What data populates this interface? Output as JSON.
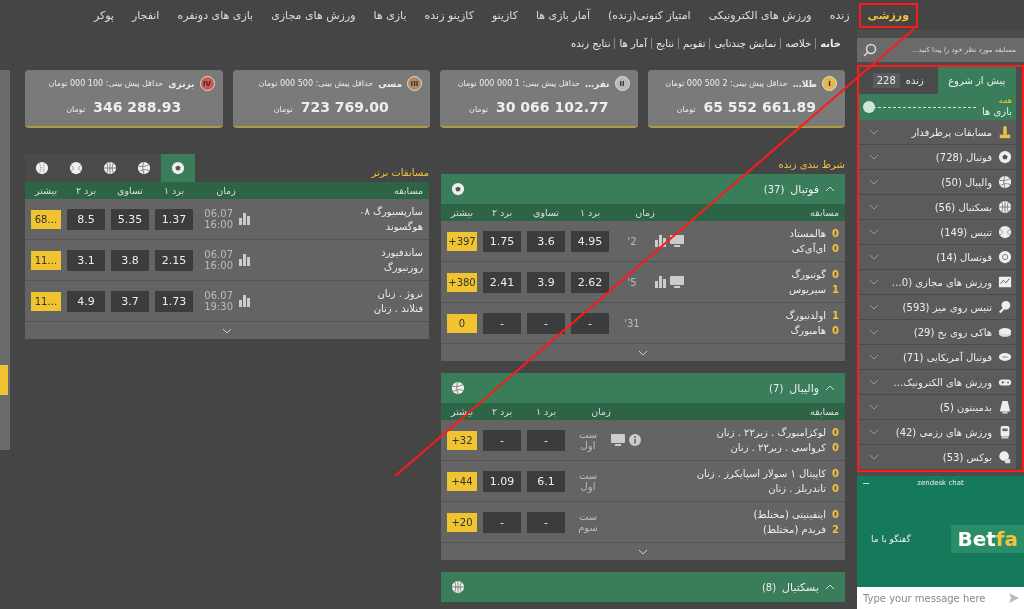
{
  "nav": [
    {
      "label": "ورزشی",
      "selected": true,
      "annotated": true
    },
    {
      "label": "زنده",
      "selected": false,
      "annotated": false
    },
    {
      "label": "ورزش های الکترونیکی",
      "selected": false,
      "annotated": false
    },
    {
      "label": "امتیاز کنونی(زنده)",
      "selected": false,
      "annotated": false
    },
    {
      "label": "آمار بازی ها",
      "selected": false,
      "annotated": false
    },
    {
      "label": "کازینو",
      "selected": false,
      "annotated": false
    },
    {
      "label": "کازینو زنده",
      "selected": false,
      "annotated": false
    },
    {
      "label": "بازی ها",
      "selected": false,
      "annotated": false
    },
    {
      "label": "ورزش های مجازی",
      "selected": false,
      "annotated": false
    },
    {
      "label": "بازی های دونفره",
      "selected": false,
      "annotated": false
    },
    {
      "label": "انفجار",
      "selected": false,
      "annotated": false
    },
    {
      "label": "پوکر",
      "selected": false,
      "annotated": false
    }
  ],
  "breadcrumb": [
    {
      "label": "خانه",
      "selected": true
    },
    {
      "label": "خلاصه",
      "selected": false
    },
    {
      "label": "نمایش چندتایی",
      "selected": false
    },
    {
      "label": "تقویم",
      "selected": false
    },
    {
      "label": "نتایج",
      "selected": false
    },
    {
      "label": "آمار ها",
      "selected": false
    },
    {
      "label": "نتایج زنده",
      "selected": false
    }
  ],
  "jackpots": [
    {
      "rank": "I",
      "name": "طلا…",
      "min": "حداقل پیش بینی: 2 500 000 تومان",
      "amount": "65 552 661.89",
      "unit": "تومان",
      "color": "#e2b84a"
    },
    {
      "rank": "II",
      "name": "نقر…",
      "min": "حداقل پیش بینی: 1 000 000 تومان",
      "amount": "30 066 102.77",
      "unit": "تومان",
      "color": "#b8b8b8"
    },
    {
      "rank": "III",
      "name": "مسی",
      "min": "حداقل پیش بینی: 500 000 تومان",
      "amount": "723 769.00",
      "unit": "تومان",
      "color": "#b58a62"
    },
    {
      "rank": "IV",
      "name": "برنزی",
      "min": "حداقل پیش بینی: 100 000 تومان",
      "amount": "346 288.93",
      "unit": "تومان",
      "color": "#d2574c"
    }
  ],
  "live": {
    "title": "شرط بندی زنده",
    "groups": [
      {
        "kind": "football",
        "name": "فوتبال",
        "count": "(37)",
        "columns": [
          "مسابقه",
          "زمان",
          "برد ۱",
          "تساوی",
          "برد ۲",
          "بیشتر"
        ],
        "rows": [
          {
            "home": "هالمستاد",
            "home_score": "0",
            "away": "ای‌آی‌کی",
            "away_score": "0",
            "time": "2'",
            "tv": true,
            "stats": true,
            "info": false,
            "odds": [
              "4.95",
              "3.6",
              "1.75"
            ],
            "more": "+397"
          },
          {
            "home": "گوتبورگ",
            "home_score": "0",
            "away": "سیریوس",
            "away_score": "1",
            "time": "5'",
            "tv": true,
            "stats": true,
            "info": false,
            "odds": [
              "2.62",
              "3.9",
              "2.41"
            ],
            "more": "+380"
          },
          {
            "home": "اولدنبورگ",
            "home_score": "1",
            "away": "هامبورگ",
            "away_score": "0",
            "time": "31'",
            "tv": false,
            "stats": false,
            "info": false,
            "odds": [
              "-",
              "-",
              "-"
            ],
            "more": "0"
          }
        ]
      },
      {
        "kind": "volleyball",
        "name": "والیبال",
        "count": "(7)",
        "columns": [
          "مسابقه",
          "زمان",
          "برد ۱",
          "برد ۲",
          "بیشتر"
        ],
        "rows": [
          {
            "home": "لوکزامبورگ . زیر۲۲ . زنان",
            "home_score": "0",
            "away": "کرواسی . زیر۲۲ . زنان",
            "away_score": "0",
            "time": "ست اول",
            "tv": true,
            "stats": false,
            "info": true,
            "odds": [
              "-",
              "-"
            ],
            "more": "+32"
          },
          {
            "home": "کاپیتال ۱ سولار اسپایکرز . زنان",
            "home_score": "0",
            "away": "تاندربلز . زنان",
            "away_score": "0",
            "time": "ست اول",
            "tv": false,
            "stats": false,
            "info": false,
            "odds": [
              "6.1",
              "1.09"
            ],
            "more": "+44"
          },
          {
            "home": "اینفینیتی (مختلط)",
            "home_score": "0",
            "away": "فریدم (مختلط)",
            "away_score": "2",
            "time": "ست سوم",
            "tv": false,
            "stats": false,
            "info": false,
            "odds": [
              "-",
              "-"
            ],
            "more": "+20"
          }
        ]
      },
      {
        "kind": "basketball",
        "name": "بسکتبال",
        "count": "(8)"
      }
    ]
  },
  "top": {
    "title": "مسابقات برتر",
    "tabs": [
      {
        "kind": "football",
        "selected": true
      },
      {
        "kind": "volleyball",
        "selected": false
      },
      {
        "kind": "basketball",
        "selected": false
      },
      {
        "kind": "tennis",
        "selected": false
      },
      {
        "kind": "baseball",
        "selected": false
      }
    ],
    "columns": [
      "مسابقه",
      "زمان",
      "برد ۱",
      "تساوی",
      "برد ۲",
      "بیشتر"
    ],
    "rows": [
      {
        "home": "سارپسبورگ ۰۸",
        "away": "هوگسوند",
        "date": "06.07",
        "hour": "16:00",
        "stats": true,
        "odds": [
          "1.37",
          "5.35",
          "8.5"
        ],
        "more": "68…"
      },
      {
        "home": "ساندفیورد",
        "away": "روزنبورگ",
        "date": "06.07",
        "hour": "16:00",
        "stats": true,
        "odds": [
          "2.15",
          "3.8",
          "3.1"
        ],
        "more": "11…"
      },
      {
        "home": "نروژ . زنان",
        "away": "فنلاند . زنان",
        "date": "06.07",
        "hour": "19:30",
        "stats": true,
        "odds": [
          "1.73",
          "3.7",
          "4.9"
        ],
        "more": "11…"
      }
    ]
  },
  "sidebar": {
    "search": {
      "placeholder": "مسابقه مورد نظر خود را پیدا کنید..."
    },
    "tabs": [
      {
        "label": "پیش از شروع",
        "selected": true
      },
      {
        "label": "زنده",
        "count": "228",
        "selected": false
      }
    ],
    "range": {
      "label_top": "همه",
      "label_bottom": "بازی ها",
      "level": 0
    },
    "annotated": true,
    "sports": [
      {
        "kind": "trophy",
        "label": "مسابقات پرطرفدار"
      },
      {
        "kind": "football",
        "label": "فوتبال (728)"
      },
      {
        "kind": "volleyball",
        "label": "والیبال (50)"
      },
      {
        "kind": "basketball",
        "label": "بسکتبال (56)"
      },
      {
        "kind": "tennis",
        "label": "تنیس (149)"
      },
      {
        "kind": "futsal",
        "label": "فوتسال (14)"
      },
      {
        "kind": "virtual",
        "label": "ورزش های مجازی (0…"
      },
      {
        "kind": "tabletennis",
        "label": "تنیس روی میز (593)"
      },
      {
        "kind": "hockey",
        "label": "هاکی روی یخ (29)"
      },
      {
        "kind": "americanfootball",
        "label": "فوتبال آمریکایی (71)"
      },
      {
        "kind": "esports",
        "label": "ورزش های الکترونیک…"
      },
      {
        "kind": "badminton",
        "label": "بدمینتون (5)"
      },
      {
        "kind": "martial",
        "label": "ورزش های رزمی (42)"
      },
      {
        "kind": "boxing",
        "label": "بوکس (53)"
      }
    ]
  },
  "chat": {
    "title": "zendesk chat",
    "minimize": "–",
    "logo_main": "Bet",
    "logo_accent": "fa",
    "greeting": "گفتگو با ما",
    "placeholder": "Type your message here"
  }
}
